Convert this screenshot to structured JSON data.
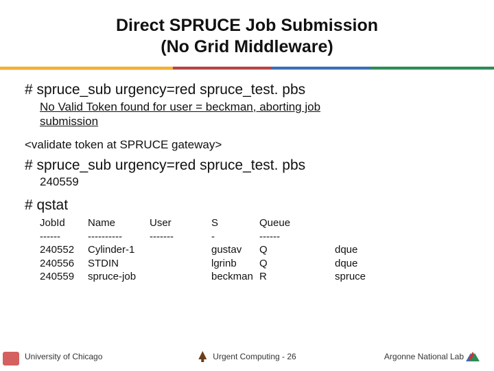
{
  "title_line1": "Direct SPRUCE Job Submission",
  "title_line2": "(No Grid Middleware)",
  "cmd1": "# spruce_sub urgency=red spruce_test. pbs",
  "out1_a": "No Valid Token found for user = beckman, aborting job",
  "out1_b": "submission",
  "validate": "<validate token at SPRUCE gateway>",
  "cmd2": "# spruce_sub urgency=red spruce_test. pbs",
  "jobid": "240559",
  "cmd3": "# qstat",
  "qstat": {
    "header": {
      "job": "JobId",
      "name": "Name",
      "user": "User",
      "s": "S",
      "queue": "Queue",
      "dest": ""
    },
    "dashes": {
      "job": "------",
      "name": "----------",
      "user": "-------",
      "s": "-",
      "queue": "------",
      "dest": ""
    },
    "rows": [
      {
        "job": "240552",
        "name": "Cylinder-1",
        "user": "",
        "s": "gustav",
        "queue": "Q",
        "dest": "dque"
      },
      {
        "job": "240556",
        "name": "STDIN",
        "user": "",
        "s": "lgrinb",
        "queue": "Q",
        "dest": "dque"
      },
      {
        "job": "240559",
        "name": "spruce-job",
        "user": "",
        "s": "beckman",
        "queue": "R",
        "dest": "spruce"
      }
    ]
  },
  "footer": {
    "left": "University of Chicago",
    "center_prefix": "Urgent Computing -",
    "page": "26",
    "right": "Argonne National Lab"
  }
}
